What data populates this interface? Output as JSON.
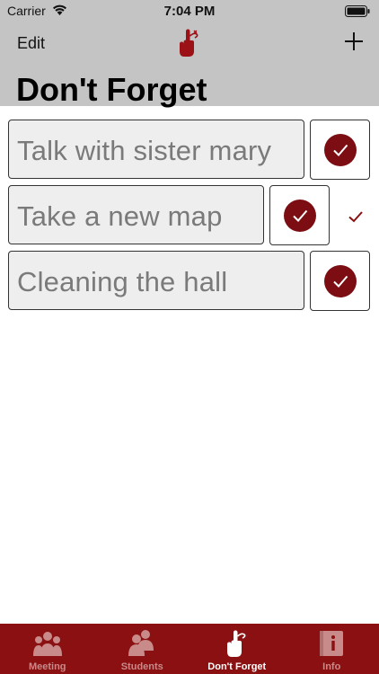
{
  "status_bar": {
    "carrier": "Carrier",
    "time": "7:04 PM"
  },
  "nav": {
    "edit_label": "Edit",
    "title": "Don't Forget"
  },
  "items": [
    {
      "text": "Talk with sister mary",
      "checked": true
    },
    {
      "text": "Take a new map",
      "checked": true,
      "swiped": true
    },
    {
      "text": "Cleaning the hall",
      "checked": true
    }
  ],
  "tabs": [
    {
      "label": "Meeting",
      "icon": "group-icon",
      "active": false
    },
    {
      "label": "Students",
      "icon": "students-icon",
      "active": false
    },
    {
      "label": "Don't Forget",
      "icon": "finger-string-icon",
      "active": true
    },
    {
      "label": "Info",
      "icon": "info-book-icon",
      "active": false
    }
  ],
  "colors": {
    "accent": "#7c0e13",
    "tabbar": "#8b1011",
    "navbar": "#c4c4c4"
  }
}
